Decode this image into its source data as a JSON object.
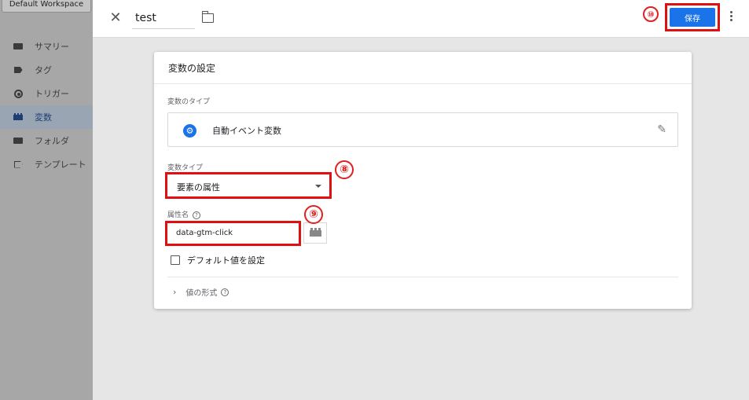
{
  "sidebar": {
    "workspace_label": "Default Workspace",
    "items": [
      {
        "label": "サマリー",
        "icon": "folder-icon",
        "active": false
      },
      {
        "label": "タグ",
        "icon": "tag-icon",
        "active": false
      },
      {
        "label": "トリガー",
        "icon": "trigger-icon",
        "active": false
      },
      {
        "label": "変数",
        "icon": "variable-icon",
        "active": true
      },
      {
        "label": "フォルダ",
        "icon": "folder-icon",
        "active": false
      },
      {
        "label": "テンプレート",
        "icon": "template-icon",
        "active": false
      }
    ]
  },
  "topbar": {
    "close_icon": "close-icon",
    "title_value": "test",
    "folder_icon": "folder-icon",
    "annotation_save": "⑩",
    "save_label": "保存",
    "more_icon": "more-vert-icon"
  },
  "card": {
    "header": "変数の設定",
    "type_label": "変数のタイプ",
    "type_name": "自動イベント変数",
    "type_icon": "gear-icon",
    "edit_icon": "pencil-icon",
    "variable_type_label": "変数タイプ",
    "variable_type_value": "要素の属性",
    "annotation_type": "⑧",
    "attribute_label": "属性名",
    "attribute_value": "data-gtm-click",
    "annotation_attr": "⑨",
    "default_checkbox_label": "デフォルト値を設定",
    "format_label": "値の形式"
  },
  "colors": {
    "accent": "#1a73e8",
    "annotation": "#e01010",
    "sidebar_bg": "#a7a7a7"
  }
}
